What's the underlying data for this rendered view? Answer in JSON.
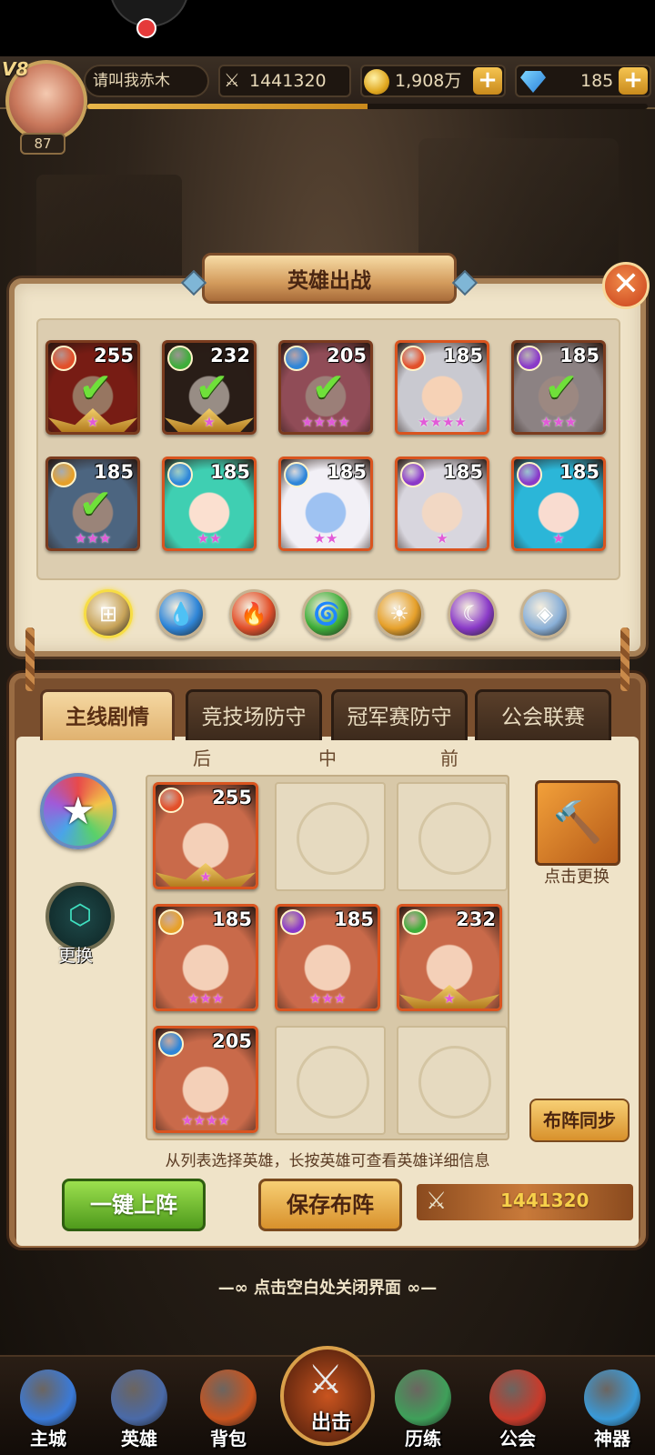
{
  "player": {
    "vip": "V8",
    "level": "87",
    "name": "请叫我赤木",
    "power": "1441320",
    "gold": "1,908万",
    "gems": "185",
    "xp_fraction": 0.5
  },
  "panel": {
    "title": "英雄出战",
    "close": "✕"
  },
  "hero_list": [
    {
      "level": "255",
      "element": "fire",
      "stars": "★",
      "selected": true,
      "portrait": "red-hair-swordsman"
    },
    {
      "level": "232",
      "element": "wind",
      "stars": "★",
      "selected": true,
      "portrait": "panda-warrior"
    },
    {
      "level": "205",
      "element": "water",
      "stars": "★★★★",
      "selected": true,
      "portrait": "pink-hair-mage"
    },
    {
      "level": "185",
      "element": "fire",
      "stars": "★★★★",
      "selected": false,
      "portrait": "white-hair-warrior"
    },
    {
      "level": "185",
      "element": "dark",
      "stars": "★★★",
      "selected": true,
      "portrait": "white-hair-girl"
    },
    {
      "level": "185",
      "element": "light",
      "stars": "★★★",
      "selected": true,
      "portrait": "blue-hair-elf"
    },
    {
      "level": "185",
      "element": "water",
      "stars": "★★",
      "selected": false,
      "portrait": "green-hair-dancer"
    },
    {
      "level": "185",
      "element": "water",
      "stars": "★★",
      "selected": false,
      "portrait": "blue-skin-priestess"
    },
    {
      "level": "185",
      "element": "dark",
      "stars": "★",
      "selected": false,
      "portrait": "white-hair-knight"
    },
    {
      "level": "185",
      "element": "dark",
      "stars": "★",
      "selected": false,
      "portrait": "teal-hair-girl"
    }
  ],
  "filters": [
    {
      "name": "all",
      "glyph": "⊞"
    },
    {
      "name": "water",
      "glyph": "💧"
    },
    {
      "name": "fire",
      "glyph": "🔥"
    },
    {
      "name": "wind",
      "glyph": "🌀"
    },
    {
      "name": "light",
      "glyph": "☀"
    },
    {
      "name": "dark",
      "glyph": "☾"
    },
    {
      "name": "neutral",
      "glyph": "◈"
    }
  ],
  "tabs": [
    {
      "label": "主线剧情",
      "active": true
    },
    {
      "label": "竞技场防守",
      "active": false
    },
    {
      "label": "冠军赛防守",
      "active": false
    },
    {
      "label": "公会联赛",
      "active": false
    }
  ],
  "columns": [
    "后",
    "中",
    "前"
  ],
  "formation": {
    "row1": [
      {
        "level": "255",
        "element": "fire",
        "stars": "★"
      }
    ],
    "row2": [
      {
        "level": "185",
        "element": "light",
        "stars": "★★★"
      },
      {
        "level": "185",
        "element": "dark",
        "stars": "★★★"
      },
      {
        "level": "232",
        "element": "wind",
        "stars": "★"
      }
    ],
    "row3": [
      {
        "level": "205",
        "element": "water",
        "stars": "★★★★"
      }
    ]
  },
  "side": {
    "swap_label": "更换",
    "artifact_label": "点击更换",
    "sync_button": "布阵同步"
  },
  "hint": "从列表选择英雄，长按英雄可查看英雄详细信息",
  "actions": {
    "auto_deploy": "一键上阵",
    "save_formation": "保存布阵",
    "team_power": "1441320"
  },
  "close_hint": "—∞ 点击空白处关闭界面 ∞—",
  "nav": [
    {
      "label": "主城",
      "icon": "castle-icon"
    },
    {
      "label": "英雄",
      "icon": "helmet-icon"
    },
    {
      "label": "背包",
      "icon": "bag-icon"
    },
    {
      "label": "出击",
      "icon": "crossed-swords-icon"
    },
    {
      "label": "历练",
      "icon": "training-icon"
    },
    {
      "label": "公会",
      "icon": "guild-icon"
    },
    {
      "label": "神器",
      "icon": "artifact-orb-icon"
    }
  ],
  "colors": {
    "fire": "#e2502a",
    "water": "#2f86d8",
    "wind": "#3fae3a",
    "light": "#e6a02a",
    "dark": "#8a3ac8",
    "neutral": "#8ab0d8"
  }
}
